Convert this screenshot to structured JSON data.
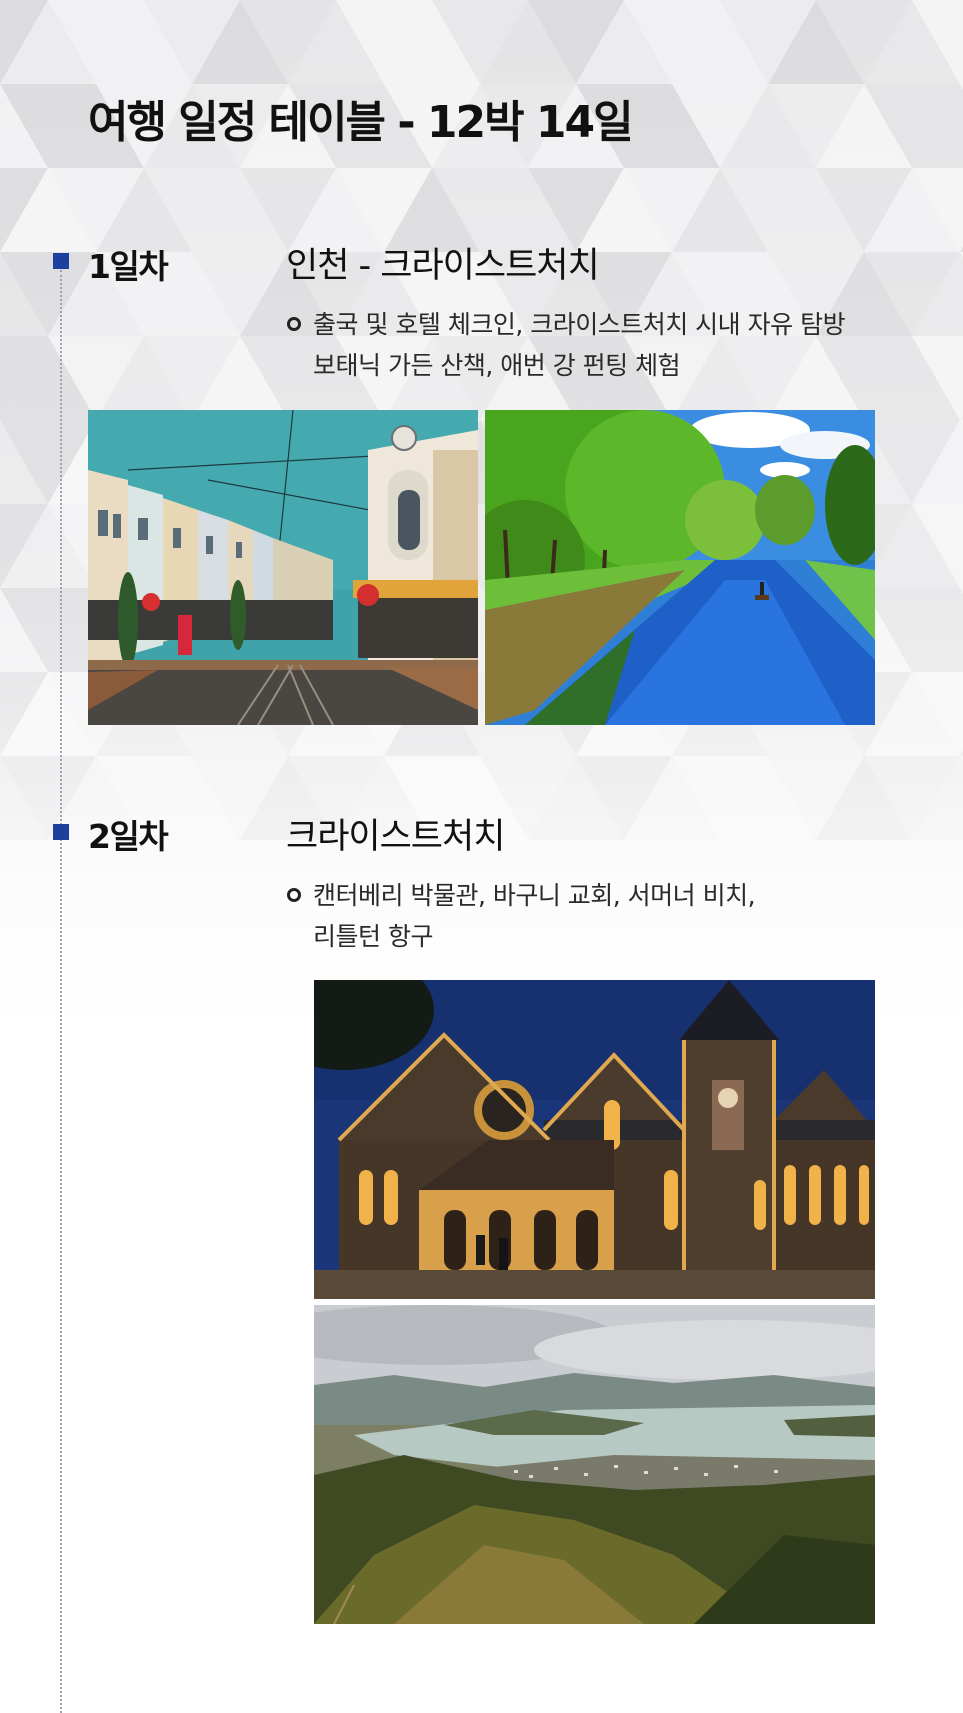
{
  "title": "여행 일정 테이블 - 12박 14일",
  "days": [
    {
      "label": "1일차",
      "route": "인천 - 크라이스트처치",
      "desc_lines": [
        "출국 및 호텔 체크인, 크라이스트처치 시내 자유 탐방",
        "보태닉 가든 산책, 애번 강 펀팅 체험"
      ],
      "photos": [
        "christchurch-street-photo",
        "avon-river-punting-photo"
      ]
    },
    {
      "label": "2일차",
      "route": "크라이스트처치",
      "desc_lines": [
        "캔터베리 박물관, 바구니 교회, 서머너 비치,",
        "리틀턴 항구"
      ],
      "photos": [
        "canterbury-museum-photo",
        "lyttelton-harbour-photo"
      ]
    }
  ],
  "colors": {
    "marker": "#1f3f9e",
    "text": "#111111",
    "background": "#f6f6f7"
  }
}
